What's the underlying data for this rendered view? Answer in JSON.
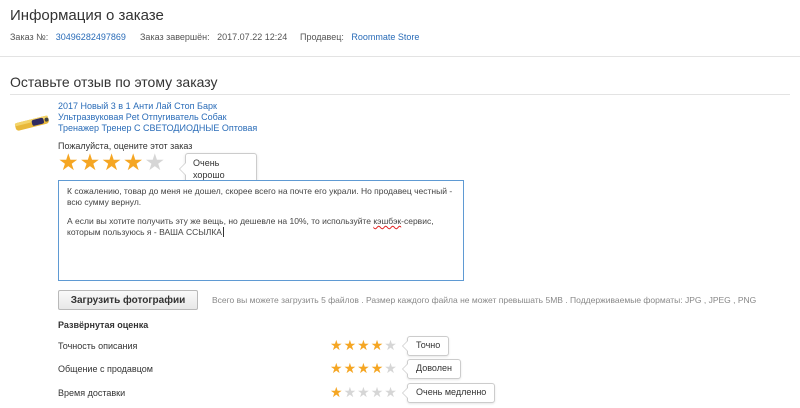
{
  "order_info": {
    "title": "Информация о заказе",
    "order_label": "Заказ №:",
    "order_number": "30496282497869",
    "completed_label": "Заказ завершён:",
    "completed_date": "2017.07.22 12:24",
    "seller_label": "Продавец:",
    "seller_name": "Roommate Store"
  },
  "review": {
    "heading": "Оставьте отзыв по этому заказу",
    "product_title_lines": [
      "2017 Новый 3 в 1 Анти Лай Стоп Барк",
      "Ультразвуковая Pet Отпугиватель Собак",
      "Тренажер Тренер С СВЕТОДИОДНЫЕ Оптовая"
    ],
    "rate_prompt": "Пожалуйста, оцените этот заказ",
    "overall_rating": 4,
    "overall_rating_max": 5,
    "overall_tooltip": "Очень хорошо",
    "text_para1": "К сожалению, товар до меня не дошел, скорее всего на почте его украли. Но продавец честный - всю сумму вернул.",
    "text_para2_before": "А если вы хотите получить эту же вещь, но дешевле на 10%, то используйте ",
    "text_para2_misspelled": "кэшбэк",
    "text_para2_after": "-сервис, которым пользуюсь я - ВАША ССЫЛКА",
    "upload_button": "Загрузить фотографии",
    "upload_hint": "Всего вы можете загрузить 5 файлов . Размер каждого файла не может превышать 5MB . Поддерживаемые форматы: JPG , JPEG , PNG"
  },
  "detailed": {
    "title": "Развёрнутая оценка",
    "rows": [
      {
        "label": "Точность описания",
        "rating": 4,
        "tooltip": "Точно"
      },
      {
        "label": "Общение с продавцом",
        "rating": 4,
        "tooltip": "Доволен"
      },
      {
        "label": "Время доставки",
        "rating": 1,
        "tooltip": "Очень медленно"
      }
    ]
  },
  "colors": {
    "link": "#2a6cb8",
    "star_on": "#f5a623",
    "star_off": "#d6d6d6",
    "textarea_border": "#5f9ad3"
  }
}
